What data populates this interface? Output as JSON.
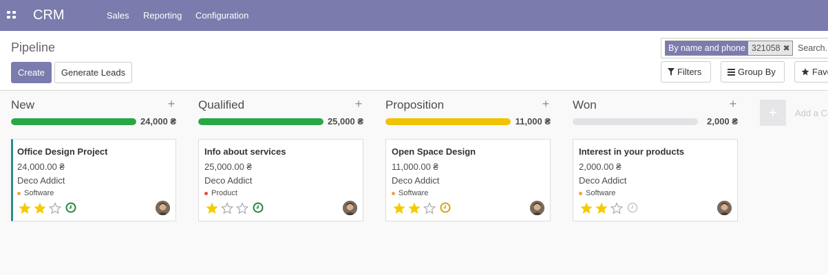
{
  "app": {
    "brand": "CRM"
  },
  "menu": [
    {
      "label": "Sales"
    },
    {
      "label": "Reporting"
    },
    {
      "label": "Configuration"
    }
  ],
  "control_panel": {
    "breadcrumb": "Pipeline",
    "create_label": "Create",
    "generate_leads_label": "Generate Leads",
    "search": {
      "facet_category": "By name and phone",
      "facet_value": "321058",
      "placeholder": "Search..."
    },
    "filters_label": "Filters",
    "group_by_label": "Group By",
    "favorites_label": "Favorites"
  },
  "colors": {
    "brand": "#7c7bad",
    "green": "#28a745",
    "yellow": "#f0c300",
    "gray": "#e2e2e6",
    "star_on": "#f3cc00",
    "star_off": "#a8a8a8"
  },
  "stages": [
    {
      "name": "New",
      "total": "24,000 ₴",
      "progress": 1.0,
      "progress_color": "#28a745",
      "card": {
        "title": "Office Design Project",
        "amount": "24,000.00 ₴",
        "partner": "Deco Addict",
        "tag": "Software",
        "tag_color": "#f0a040",
        "stars": 2,
        "activity": "clock-green",
        "activity_color": "#21863a",
        "highlight": true
      }
    },
    {
      "name": "Qualified",
      "total": "25,000 ₴",
      "progress": 1.0,
      "progress_color": "#28a745",
      "card": {
        "title": "Info about services",
        "amount": "25,000.00 ₴",
        "partner": "Deco Addict",
        "tag": "Product",
        "tag_color": "#e74c3c",
        "stars": 1,
        "activity": "clock-green",
        "activity_color": "#21863a",
        "highlight": false
      }
    },
    {
      "name": "Proposition",
      "total": "11,000 ₴",
      "progress": 1.0,
      "progress_color": "#f0c300",
      "card": {
        "title": "Open Space Design",
        "amount": "11,000.00 ₴",
        "partner": "Deco Addict",
        "tag": "Software",
        "tag_color": "#f0a040",
        "stars": 2,
        "activity": "clock-yellow",
        "activity_color": "#d4a30a",
        "highlight": false
      }
    },
    {
      "name": "Won",
      "total": "2,000 ₴",
      "progress": 0.0,
      "progress_color": "#e2e2e6",
      "card": {
        "title": "Interest in your products",
        "amount": "2,000.00 ₴",
        "partner": "Deco Addict",
        "tag": "Software",
        "tag_color": "#f0a040",
        "stars": 2,
        "activity": "clock-gray",
        "activity_color": "#d0d0d0",
        "highlight": false
      }
    }
  ],
  "add_column": {
    "icon": "plus-icon",
    "label": "Add a Column"
  }
}
